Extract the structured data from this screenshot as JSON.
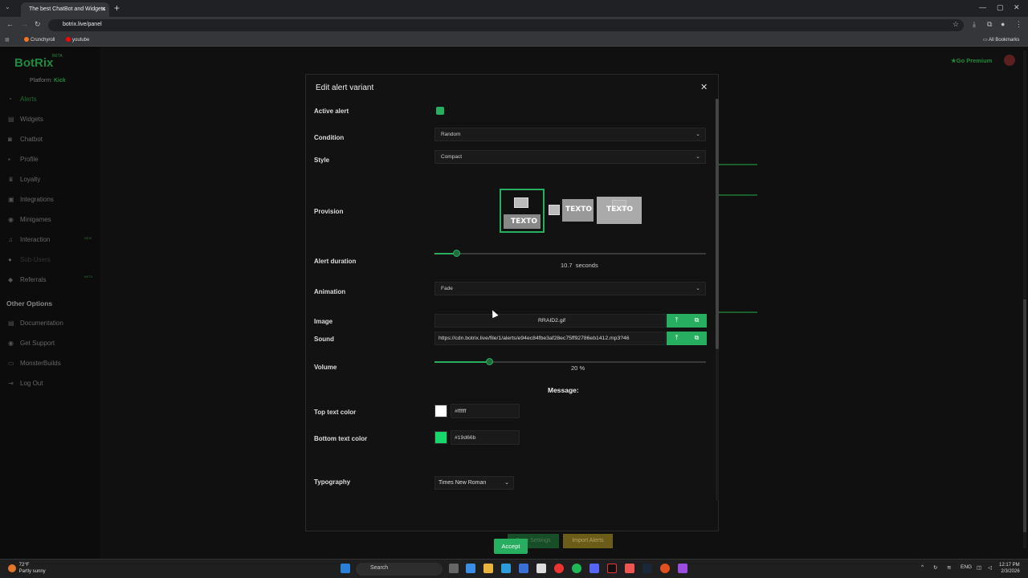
{
  "browser": {
    "tab_title": "The best ChatBot and Widgets",
    "url": "botrix.live/panel",
    "bookmarks": [
      "Crunchyroll",
      "youtube"
    ],
    "all_bookmarks": "All Bookmarks"
  },
  "app": {
    "logo": "BotRix",
    "beta": "BETA",
    "platform_label": "Platform:",
    "platform_value": "Kick",
    "go_premium": "Go Premium",
    "nav": [
      {
        "label": "Alerts",
        "icon": "bell-icon"
      },
      {
        "label": "Widgets",
        "icon": "widgets-icon"
      },
      {
        "label": "Chatbot",
        "icon": "robot-icon"
      },
      {
        "label": "Profile",
        "icon": "user-icon"
      },
      {
        "label": "Loyalty",
        "icon": "trophy-icon"
      },
      {
        "label": "Integrations",
        "icon": "plug-icon"
      },
      {
        "label": "Minigames",
        "icon": "gamepad-icon"
      },
      {
        "label": "Interaction",
        "icon": "music-icon",
        "badge": "NEW"
      },
      {
        "label": "Sub-Users",
        "icon": "users-icon"
      },
      {
        "label": "Referrals",
        "icon": "referral-icon",
        "badge": "BETA"
      }
    ],
    "other_options": "Other Options",
    "other_nav": [
      {
        "label": "Documentation",
        "icon": "doc-icon"
      },
      {
        "label": "Get Support",
        "icon": "support-icon"
      },
      {
        "label": "MonsterBuilds",
        "icon": "monitor-icon"
      },
      {
        "label": "Log Out",
        "icon": "logout-icon"
      }
    ],
    "save_settings": "Save Settings",
    "import_alerts": "Import Alerts"
  },
  "modal": {
    "title": "Edit alert variant",
    "active_alert_label": "Active alert",
    "active_alert_checked": true,
    "condition_label": "Condition",
    "condition_value": "Random",
    "style_label": "Style",
    "style_value": "Compact",
    "provision_label": "Provision",
    "provision_options": [
      "TEXTO",
      "TEXTO",
      "TEXTO"
    ],
    "provision_selected": 0,
    "duration_label": "Alert duration",
    "duration_value": "10.7",
    "duration_unit": "seconds",
    "duration_fraction": 0.08,
    "animation_label": "Animation",
    "animation_value": "Fade",
    "image_label": "Image",
    "image_file": "RRAID2.gif",
    "sound_label": "Sound",
    "sound_url": "https://cdn.botrix.live/file/1/alerts/e94ec84fbe3af28ec75ff92786eb1412.mp3?46",
    "volume_label": "Volume",
    "volume_value": "20",
    "volume_unit": "%",
    "volume_fraction": 0.2,
    "message_heading": "Message:",
    "top_text_color_label": "Top text color",
    "top_text_color": "#ffffff",
    "bottom_text_color_label": "Bottom text color",
    "bottom_text_color": "#19d66b",
    "typography_label": "Typography",
    "typography_value": "Times New Roman",
    "accept_label": "Accept"
  },
  "taskbar": {
    "temp": "72°F",
    "weather": "Partly sunny",
    "search": "Search",
    "lang": "ENG",
    "time": "12:17 PM",
    "date": "2/3/2026"
  },
  "colors": {
    "accent": "#27ae60",
    "brand": "#1f8a3b"
  }
}
